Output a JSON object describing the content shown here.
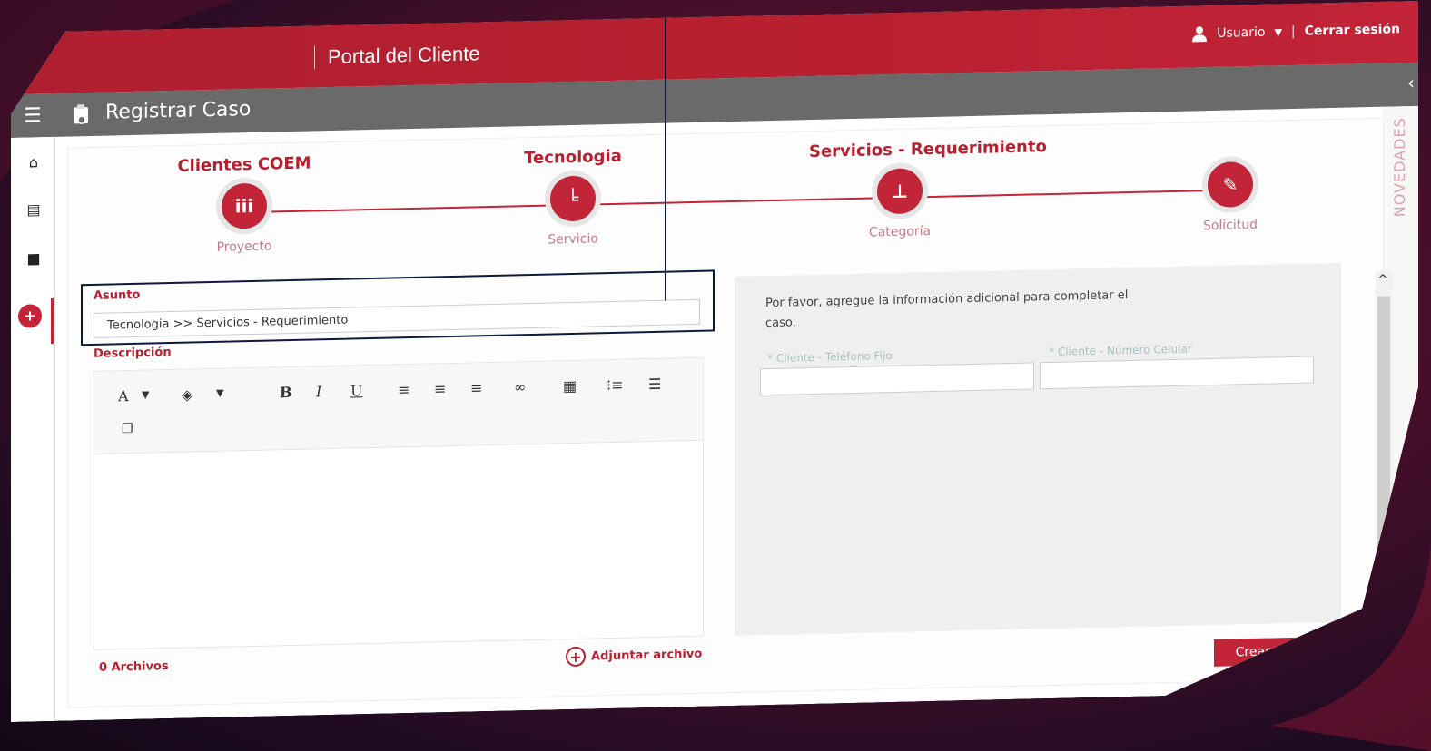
{
  "header": {
    "portal_title": "Portal del Cliente",
    "user_label": "Usuario",
    "separator": "|",
    "logout_label": "Cerrar sesión"
  },
  "titlebar": {
    "title": "Registrar Caso"
  },
  "right_tab": {
    "label": "NOVEDADES"
  },
  "steps": [
    {
      "top": "Clientes COEM",
      "bottom": "Proyecto",
      "icon": "people-icon"
    },
    {
      "top": "Tecnologia",
      "bottom": "Servicio",
      "icon": "service-icon"
    },
    {
      "top": "Servicios - Requerimiento",
      "bottom": "Categoría",
      "icon": "hierarchy-icon"
    },
    {
      "top": "",
      "bottom": "Solicitud",
      "icon": "document-edit-icon"
    }
  ],
  "form": {
    "subject_label": "Asunto",
    "subject_value": "Tecnologia >> Servicios - Requerimiento",
    "description_label": "Descripción",
    "files_label": "0 Archivos",
    "attach_label": "Adjuntar archivo"
  },
  "toolbar": {
    "font_color": "A",
    "bold": "B",
    "italic": "I",
    "underline": "U"
  },
  "info_panel": {
    "message": "Por favor, agregue la información adicional para completar el caso.",
    "field_landline_label": "* Cliente - Teléfono Fijo",
    "field_landline_value": "",
    "field_mobile_label": "* Cliente - Número Celular",
    "field_mobile_value": "",
    "create_button": "Crear caso"
  },
  "colors": {
    "brand_red": "#c22438",
    "dark_bar": "#6a6a6a",
    "callout_navy": "#0c1a3a"
  }
}
